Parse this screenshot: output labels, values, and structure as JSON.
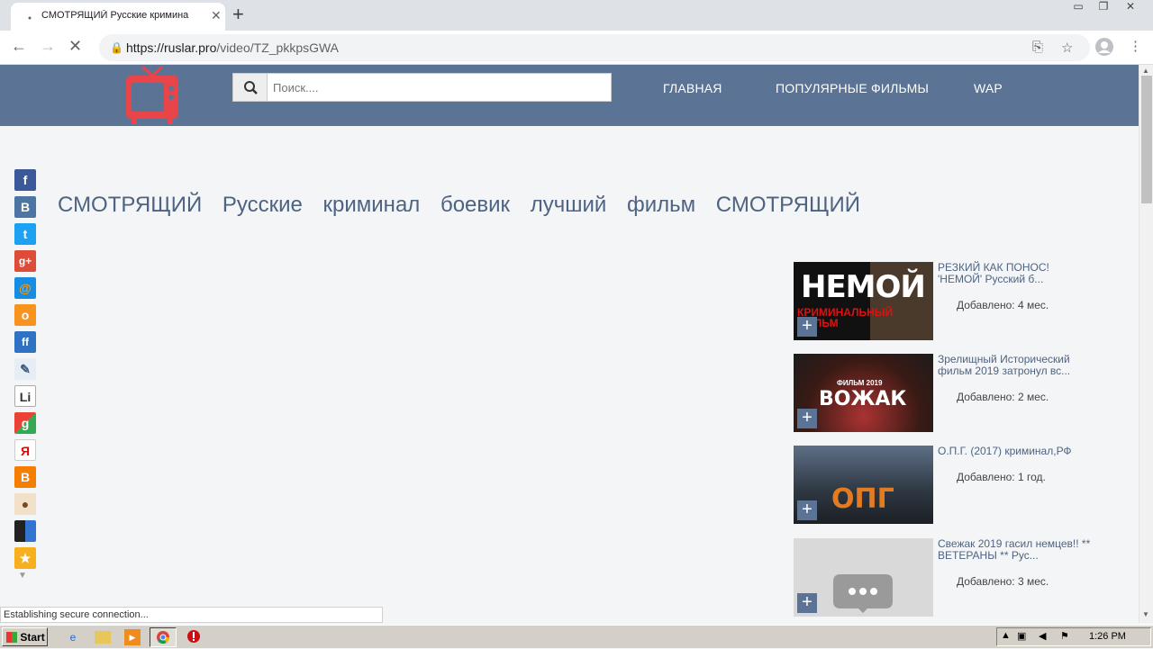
{
  "browser": {
    "tab_title": "СМОТРЯЩИЙ Русские кримина",
    "tab_close": "✕",
    "new_tab": "+",
    "url_domain": "https://ruslar.pro",
    "url_path": "/video/TZ_pkkpsGWA",
    "status": "Establishing secure connection..."
  },
  "site": {
    "search_placeholder": "Поиск....",
    "menu": [
      "ГЛАВНАЯ",
      "ПОПУЛЯРНЫЕ ФИЛЬМЫ",
      "WAP"
    ],
    "brand_color": "#5b7394",
    "logo_color": "#e8454a"
  },
  "share_icons": [
    "facebook-icon",
    "vkontakte-icon",
    "twitter-icon",
    "google-plus-icon",
    "mailru-icon",
    "odnoklassniki-icon",
    "friendfeed-icon",
    "livejournal-icon",
    "liveinternet-icon",
    "google-bookmarks-icon",
    "yandex-icon",
    "blogger-icon",
    "moemesto-icon",
    "delicious-icon",
    "favorites-icon"
  ],
  "page": {
    "title": "СМОТРЯЩИЙ Русские криминал боевик лучший фильм СМОТРЯЩИЙ"
  },
  "related": [
    {
      "title": "РЕЗКИЙ КАК ПОНОС! 'НЕМОЙ' Русский б...",
      "added": "Добавлено: 4 мес.",
      "thumb_text": "НЕМОЙ",
      "thumb_sub": "КРИМИНАЛЬНЫЙ ФИЛЬМ"
    },
    {
      "title": "Зрелищный Исторический фильм 2019 затронул вс...",
      "added": "Добавлено: 2 мес.",
      "thumb_text": "ВОЖАК",
      "thumb_sub": "ФИЛЬМ 2019"
    },
    {
      "title": "О.П.Г. (2017) криминал,РФ",
      "added": "Добавлено: 1 год.",
      "thumb_text": "ОПГ",
      "thumb_sub": ""
    },
    {
      "title": "Свежак 2019 гасил немцев!! ** ВЕТЕРАНЫ ** Рус...",
      "added": "Добавлено: 3 мес.",
      "thumb_text": "",
      "thumb_sub": ""
    }
  ],
  "taskbar": {
    "start": "Start",
    "time": "1:26 PM"
  }
}
